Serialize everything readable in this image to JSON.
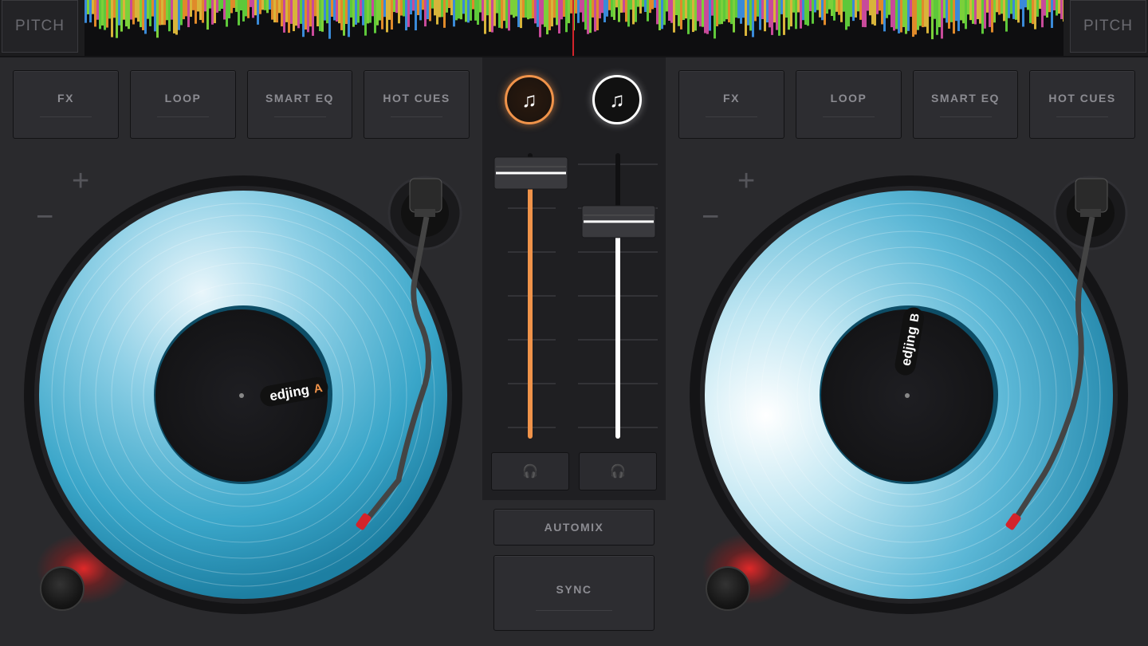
{
  "top": {
    "pitch_left_label": "PITCH",
    "pitch_right_label": "PITCH"
  },
  "deck_a": {
    "buttons": [
      "FX",
      "LOOP",
      "SMART EQ",
      "HOT CUES"
    ],
    "plus": "+",
    "minus": "−",
    "label_brand": "edjing",
    "label_letter": "A"
  },
  "deck_b": {
    "buttons": [
      "FX",
      "LOOP",
      "SMART EQ",
      "HOT CUES"
    ],
    "plus": "+",
    "minus": "−",
    "label_brand": "edjing",
    "label_letter": "B"
  },
  "mixer": {
    "add_track_icon": "♫",
    "headphone_icon": "🎧",
    "volume_a": 0.93,
    "volume_b": 0.76,
    "automix_label": "AUTOMIX",
    "sync_label": "SYNC"
  },
  "colors": {
    "deck_a_accent": "#f0934a",
    "deck_b_accent": "#ffffff",
    "playhead": "#d3242b"
  }
}
